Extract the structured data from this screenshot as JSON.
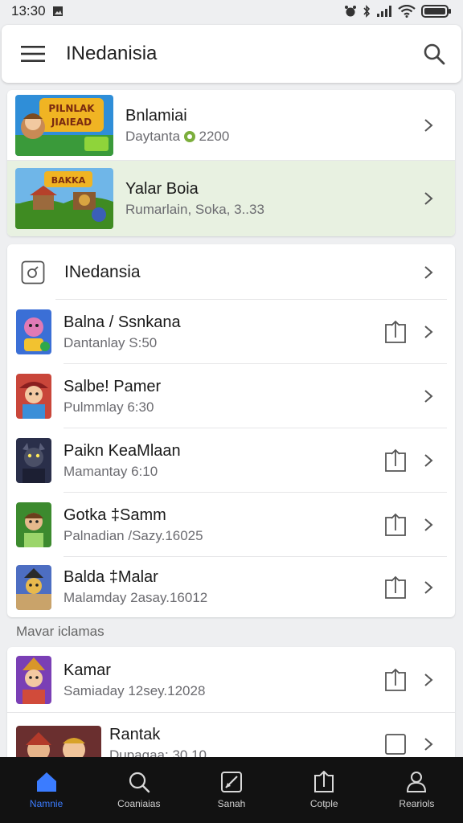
{
  "status": {
    "time": "13:30"
  },
  "appbar": {
    "title": "INedanisia"
  },
  "featured": [
    {
      "title": "Bnlamiai",
      "subtitle_prefix": "Daytanta",
      "subtitle_suffix": "2200"
    },
    {
      "title": "Yalar Boia",
      "subtitle": "Rumarlain, Soka, 3..33"
    }
  ],
  "list": {
    "header": "INedansia",
    "items": [
      {
        "title": "Balna / Ssnkana",
        "subtitle": "Dantanlay S:50"
      },
      {
        "title": "Salbe! Pamer",
        "subtitle": "Pulmmlay 6:30"
      },
      {
        "title": "Paikn KeaMlaan",
        "subtitle": "Mamantay 6:10"
      },
      {
        "title": "Gotka ‡Samm",
        "subtitle": "Palnadian /Sazy.16025"
      },
      {
        "title": "Balda ‡Malar",
        "subtitle": "Malamday 2asay.16012"
      }
    ]
  },
  "section2": {
    "label": "Mavar iclamas",
    "items": [
      {
        "title": "Kamar",
        "subtitle": "Samiaday 12sey.12028"
      },
      {
        "title": "Rantak",
        "subtitle": "Dupagaa: 30.10"
      }
    ]
  },
  "bottom_nav": [
    {
      "label": "Namnie",
      "icon": "home-icon",
      "active": true
    },
    {
      "label": "Coaniaias",
      "icon": "search-icon",
      "active": false
    },
    {
      "label": "Sanah",
      "icon": "edit-icon",
      "active": false
    },
    {
      "label": "Cotple",
      "icon": "share-icon",
      "active": false
    },
    {
      "label": "Reariols",
      "icon": "profile-icon",
      "active": false
    }
  ],
  "colors": {
    "accent": "#3b7cff",
    "highlight_row": "#e8f1e1",
    "nav_bg": "#121212"
  }
}
